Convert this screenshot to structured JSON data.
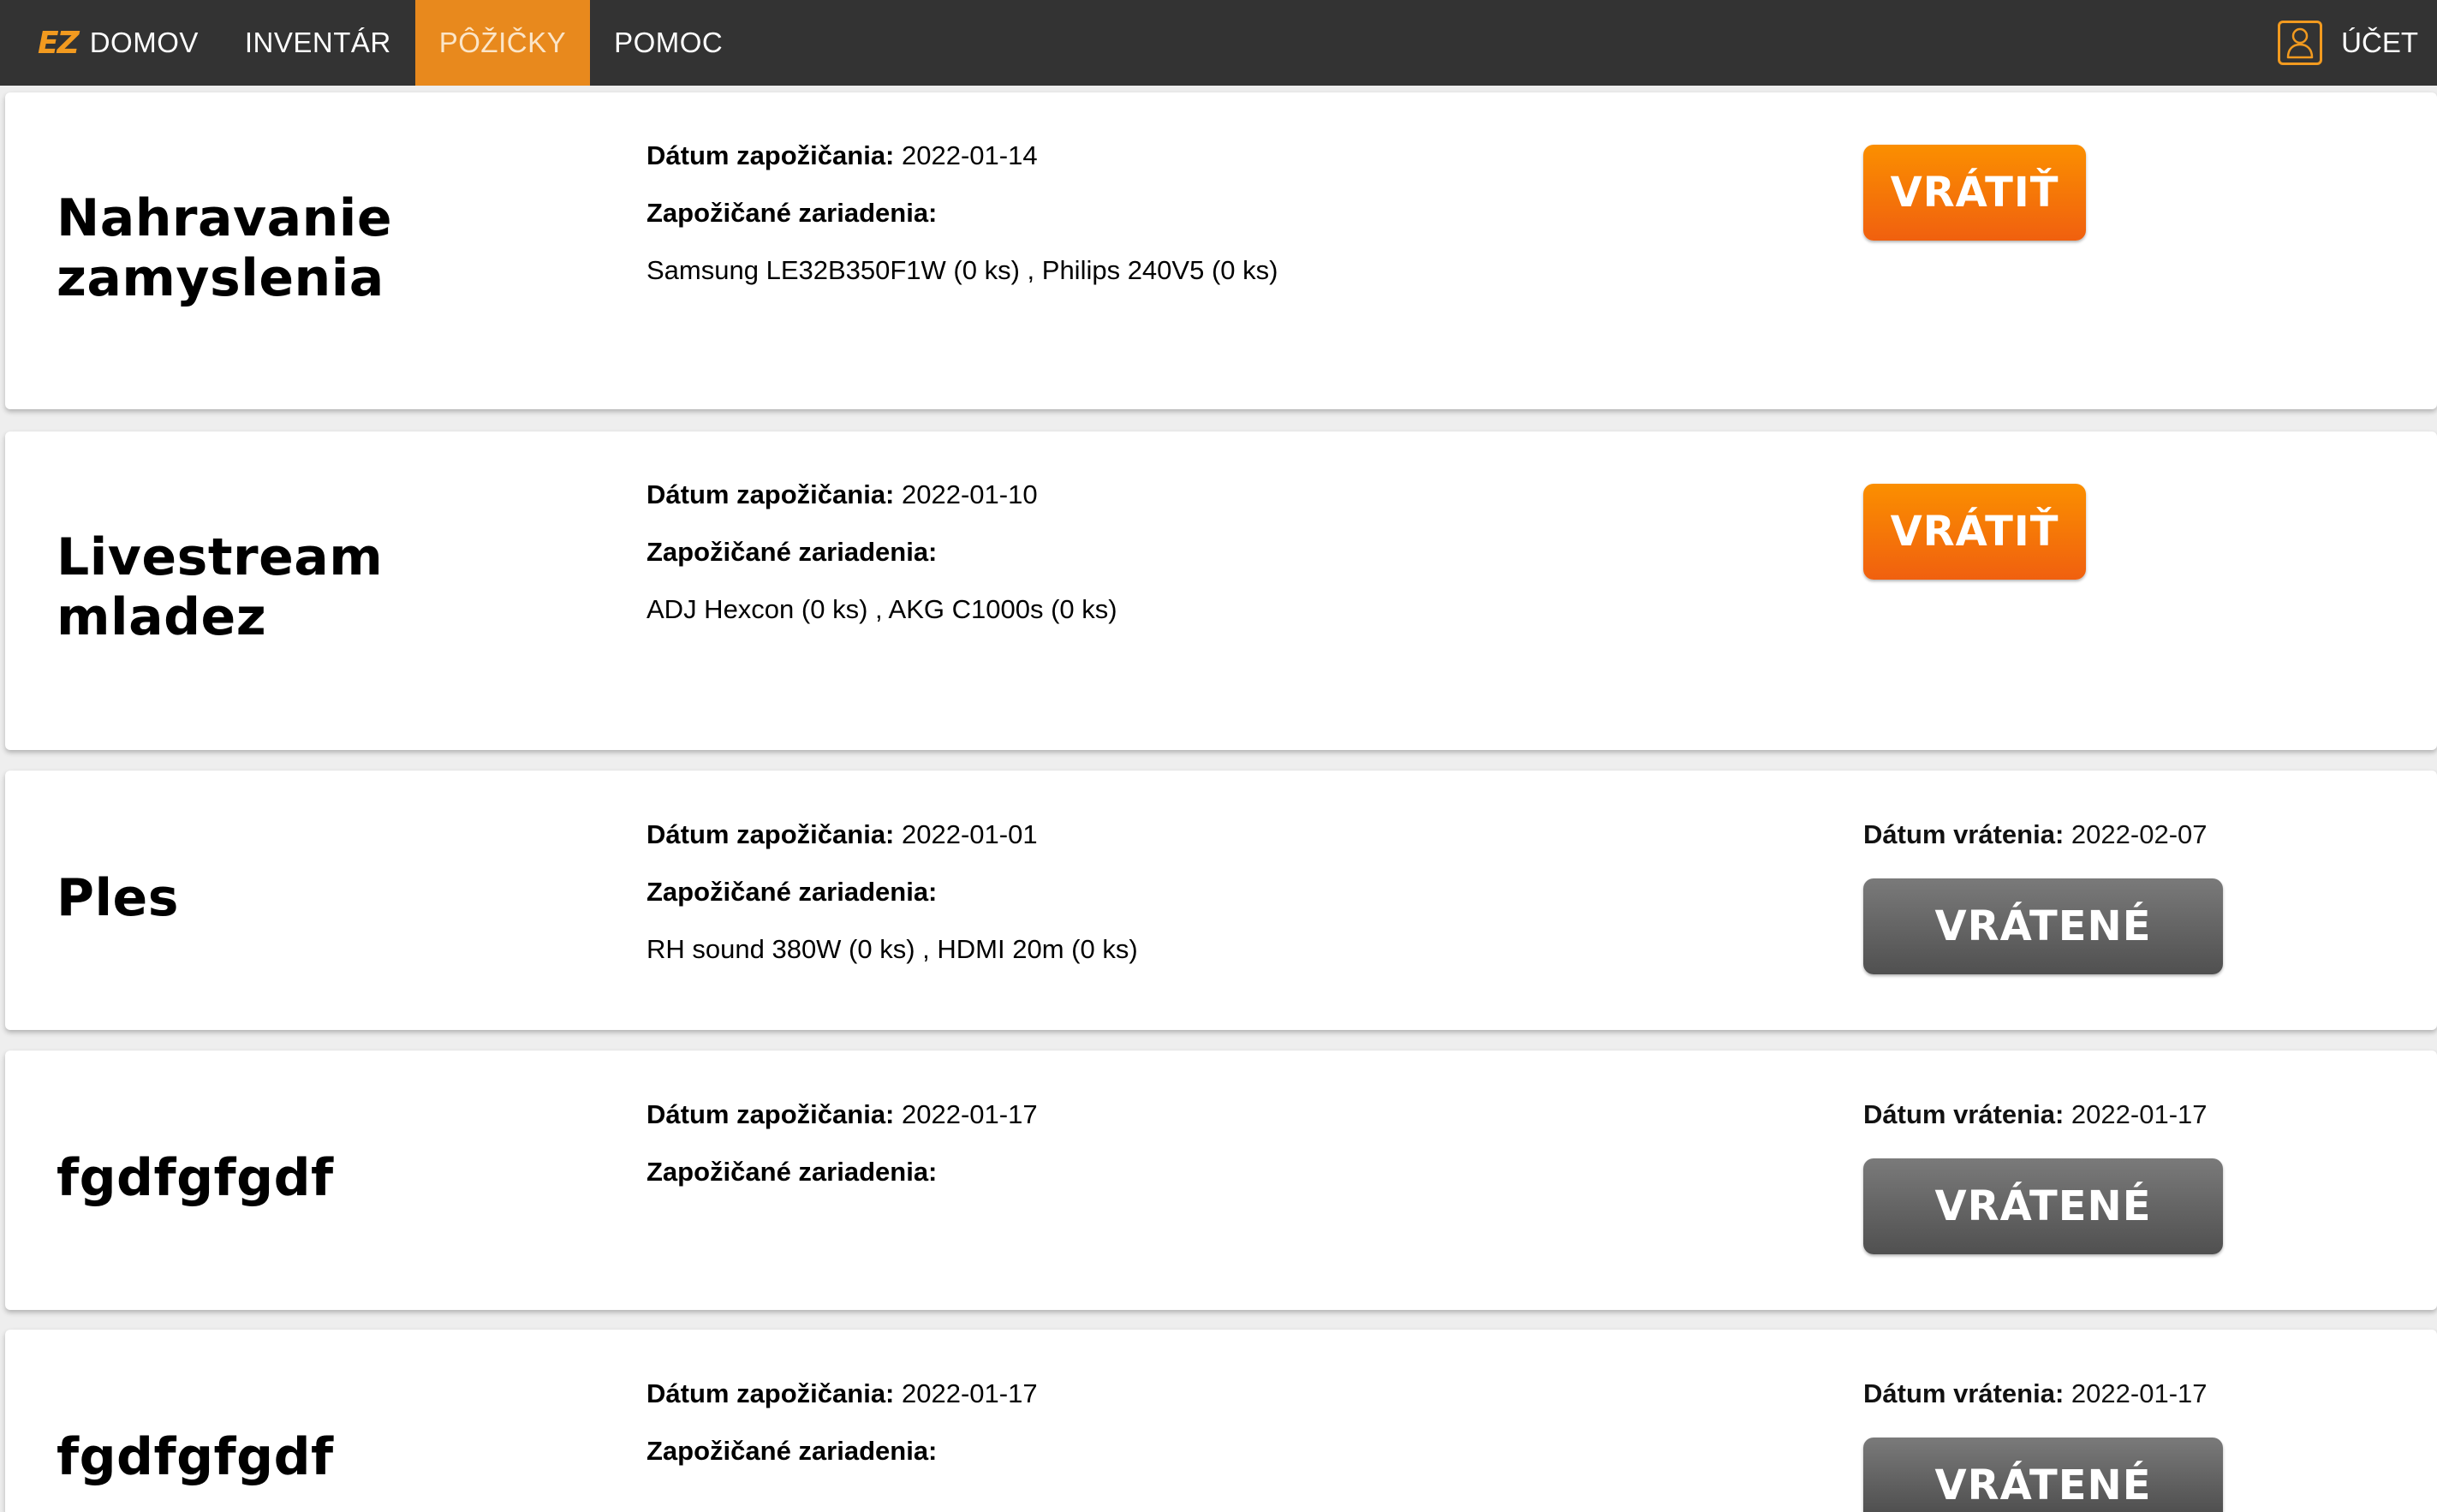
{
  "nav": {
    "brand_logo": "EZ",
    "items": [
      {
        "label": "DOMOV"
      },
      {
        "label": "INVENTÁR"
      },
      {
        "label": "PÔŽIČKY"
      },
      {
        "label": "POMOC"
      }
    ],
    "account_label": "ÚČET",
    "accent_color": "#e8891d"
  },
  "labels": {
    "loan_date": "Dátum zapožičania:",
    "devices": "Zapožičané zariadenia:",
    "return_date": "Dátum vrátenia:"
  },
  "loans": [
    {
      "title": "Nahravanie zamyslenia",
      "loan_date": "2022-01-14",
      "devices": "Samsung LE32B350F1W (0 ks) , Philips 240V5 (0 ks)",
      "button": "VRÁTIŤ"
    },
    {
      "title": "Livestream mladez",
      "loan_date": "2022-01-10",
      "devices": "ADJ Hexcon (0 ks) , AKG C1000s (0 ks)",
      "button": "VRÁTIŤ"
    },
    {
      "title": "Ples",
      "loan_date": "2022-01-01",
      "devices": "RH sound 380W (0 ks) , HDMI 20m (0 ks)",
      "return_date": "2022-02-07",
      "button": "VRÁTENÉ"
    },
    {
      "title": "fgdfgfgdf",
      "loan_date": "2022-01-17",
      "devices": "",
      "return_date": "2022-01-17",
      "button": "VRÁTENÉ"
    },
    {
      "title": "fgdfgfgdf",
      "loan_date": "2022-01-17",
      "devices": "",
      "return_date": "2022-01-17",
      "button": "VRÁTENÉ"
    }
  ]
}
